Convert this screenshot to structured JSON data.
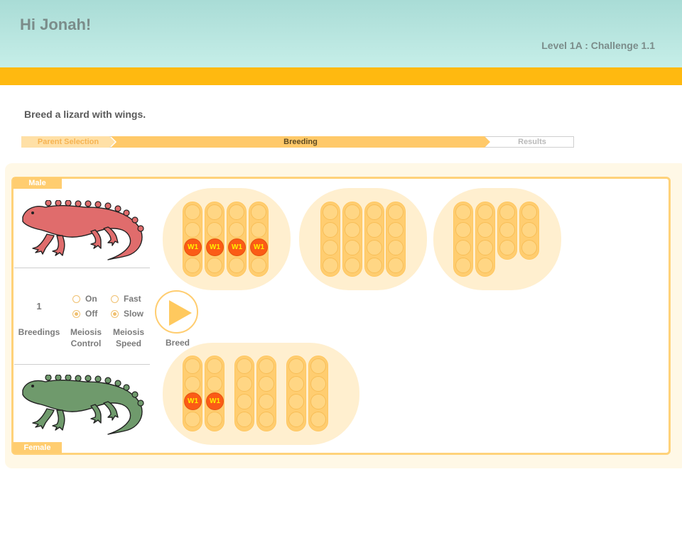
{
  "header": {
    "greeting": "Hi Jonah!",
    "level": "Level 1A : Challenge 1.1",
    "colors": {
      "gradient_top": "#a9dcd6",
      "gradient_bottom": "#c6eee8",
      "accent_bar": "#ffb910"
    }
  },
  "instruction": "Breed a lizard with wings.",
  "progress": {
    "steps": [
      "Parent Selection",
      "Breeding",
      "Results"
    ],
    "active": "Breeding"
  },
  "parents": {
    "male_label": "Male",
    "female_label": "Female",
    "male_color": "#e06c6c",
    "female_color": "#6f9a6c"
  },
  "controls": {
    "breedings_value": "1",
    "breedings_label": "Breedings",
    "meiosis_control": {
      "options": [
        "On",
        "Off"
      ],
      "selected": "Off",
      "label_line1": "Meiosis",
      "label_line2": "Control"
    },
    "meiosis_speed": {
      "options": [
        "Fast",
        "Slow"
      ],
      "selected": "Slow",
      "label_line1": "Meiosis",
      "label_line2": "Speed"
    },
    "breed_label": "Breed"
  },
  "chromosomes": {
    "allele_label": "W1",
    "male": [
      {
        "name": "pair-1",
        "alleles": [
          "W1",
          "W1",
          "W1",
          "W1"
        ]
      },
      {
        "name": "pair-2",
        "alleles": []
      },
      {
        "name": "pair-3",
        "alleles": []
      }
    ],
    "female": [
      {
        "name": "pair-1",
        "alleles": [
          "W1",
          "W1"
        ]
      },
      {
        "name": "pair-2",
        "alleles": []
      },
      {
        "name": "pair-3",
        "alleles": []
      }
    ]
  }
}
